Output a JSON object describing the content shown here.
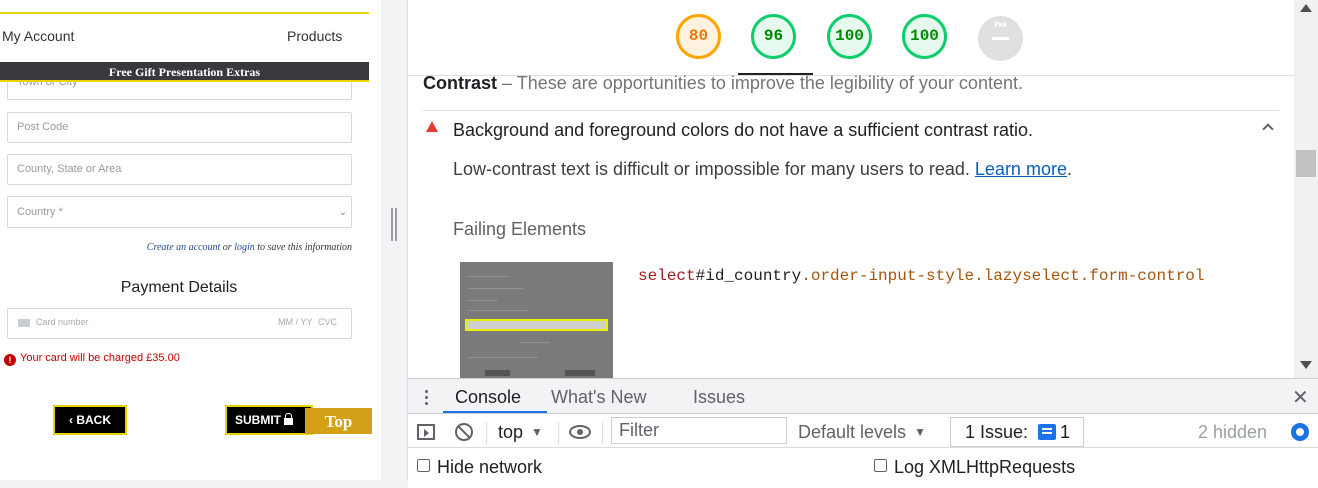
{
  "left_page": {
    "nav": {
      "account": "My Account",
      "products": "Products"
    },
    "promo_bar": "Free Gift Presentation Extras",
    "fields": {
      "town_placeholder": "Town or City",
      "postcode_placeholder": "Post Code",
      "county_placeholder": "County, State or Area",
      "country_selected": "Country *"
    },
    "create_account": {
      "link1": "Create an account",
      "or": "or",
      "link2": "login",
      "rest": "to save this information"
    },
    "payment_title": "Payment Details",
    "card": {
      "number_placeholder": "Card number",
      "expiry_placeholder": "MM / YY",
      "cvc_placeholder": "CVC"
    },
    "charge_notice": "Your card will be charged £35.00",
    "buttons": {
      "back": "BACK",
      "submit": "SUBMIT",
      "top": "Top"
    }
  },
  "lighthouse": {
    "scores": [
      {
        "value": "80",
        "status": "average"
      },
      {
        "value": "96",
        "status": "pass"
      },
      {
        "value": "100",
        "status": "pass"
      },
      {
        "value": "100",
        "status": "pass"
      }
    ],
    "pwa_label": "PWA",
    "section": {
      "title": "Contrast",
      "description": "These are opportunities to improve the legibility of your content."
    },
    "audit": {
      "title": "Background and foreground colors do not have a sufficient contrast ratio.",
      "description": "Low-contrast text is difficult or impossible for many users to read.",
      "learn_more": "Learn more"
    },
    "failing_elements_label": "Failing Elements",
    "selector": {
      "tag": "select",
      "id": "#id_country",
      "classes": ".order-input-style.lazyselect.form-control"
    }
  },
  "drawer": {
    "tabs": [
      "Console",
      "What's New",
      "Issues"
    ],
    "context": "top",
    "filter_placeholder": "Filter",
    "levels": "Default levels",
    "issues_label": "1 Issue:",
    "issues_count": "1",
    "hidden_count": "2 hidden",
    "options": {
      "hide_network": "Hide network",
      "log_xhr": "Log XMLHttpRequests"
    }
  },
  "colors": {
    "accent_yellow": "#e8d400",
    "score_orange": "#ffa400",
    "score_green": "#0cce6b",
    "link_blue": "#1a73e8",
    "error_red": "#c40000"
  }
}
